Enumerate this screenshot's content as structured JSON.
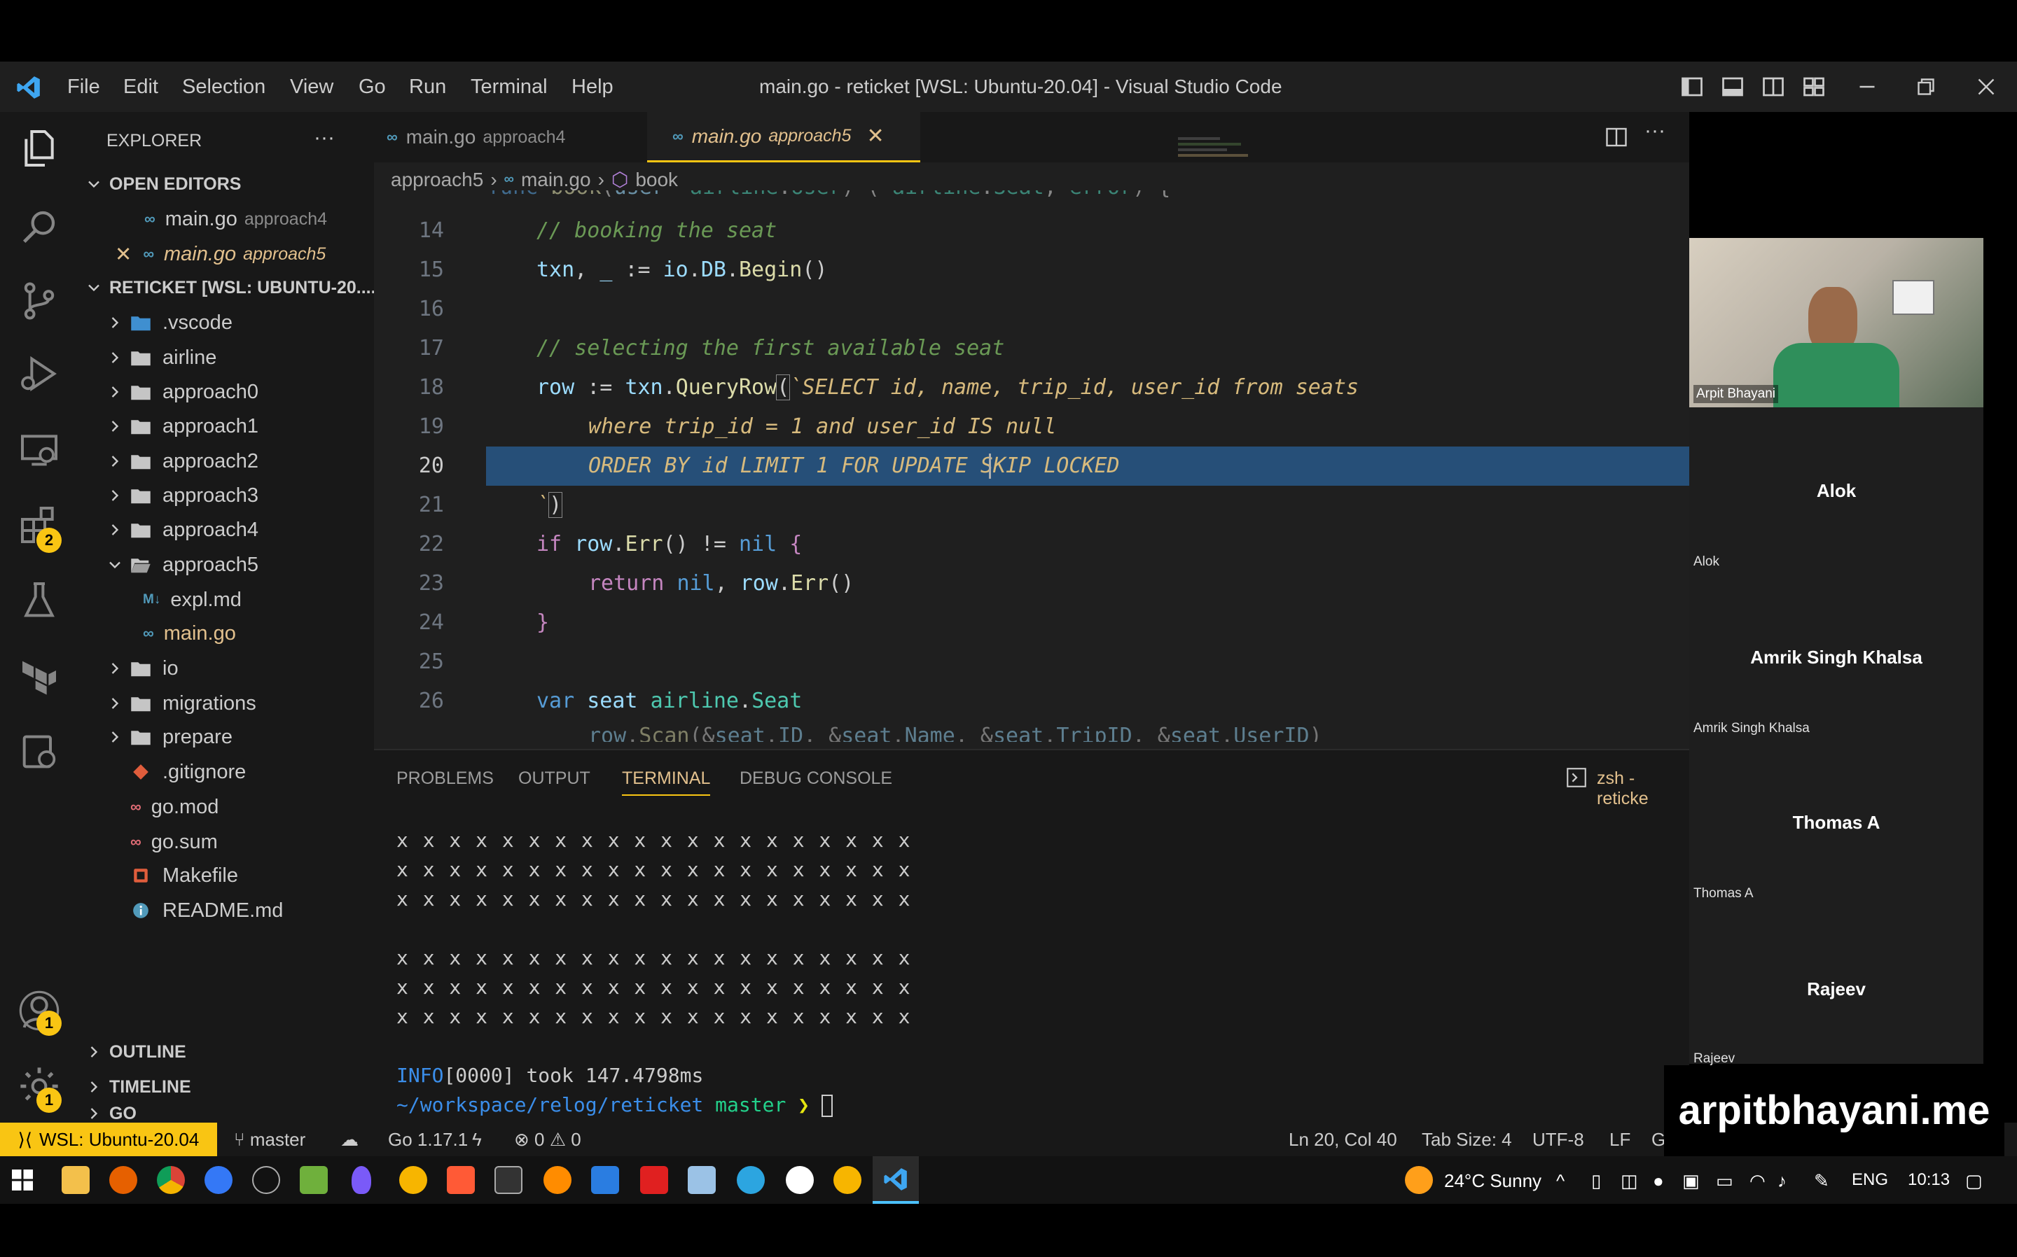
{
  "menu": [
    "File",
    "Edit",
    "Selection",
    "View",
    "Go",
    "Run",
    "Terminal",
    "Help"
  ],
  "window_title": "main.go - reticket [WSL: Ubuntu-20.04] - Visual Studio Code",
  "sidebar": {
    "explorer_title": "EXPLORER",
    "open_editors_label": "OPEN EDITORS",
    "open_editors": [
      {
        "name": "main.go",
        "folder": "approach4"
      },
      {
        "name": "main.go",
        "folder": "approach5"
      }
    ],
    "project_label": "RETICKET [WSL: UBUNTU-20....",
    "tree": [
      ".vscode",
      "airline",
      "approach0",
      "approach1",
      "approach2",
      "approach3",
      "approach4",
      "approach5",
      "expl.md",
      "main.go",
      "io",
      "migrations",
      "prepare",
      ".gitignore",
      "go.mod",
      "go.sum",
      "Makefile",
      "README.md"
    ],
    "outline_label": "OUTLINE",
    "timeline_label": "TIMELINE",
    "go_label": "GO"
  },
  "activity_badges": {
    "extensions": "2",
    "accounts": "1",
    "settings": "1"
  },
  "tabs": [
    {
      "name": "main.go",
      "folder": "approach4"
    },
    {
      "name": "main.go",
      "folder": "approach5"
    }
  ],
  "breadcrumb": {
    "folder": "approach5",
    "file": "main.go",
    "symbol": "book"
  },
  "code": {
    "line_numbers": [
      "14",
      "15",
      "16",
      "17",
      "18",
      "19",
      "20",
      "21",
      "22",
      "23",
      "24",
      "25",
      "26"
    ],
    "l14": "// booking the seat",
    "l17": "// selecting the first available seat",
    "l18_sql": "SELECT id, name, trip_id, user_id from seats",
    "l19_sql": "where trip_id = 1 and user_id IS null",
    "l20_sql": "ORDER BY id LIMIT 1 FOR UPDATE SKIP LOCKED"
  },
  "panel": {
    "tabs": [
      "PROBLEMS",
      "OUTPUT",
      "TERMINAL",
      "DEBUG CONSOLE"
    ],
    "shell": "zsh - reticke",
    "seat_row": "x x x x x x x x x x x x x x x x x x x x",
    "info_line": "INFO[0000] took 147.4798ms",
    "prompt_path": "~/workspace/relog/reticket",
    "prompt_branch": "master",
    "prompt_symbol": "❯"
  },
  "video": {
    "presenter": "Arpit Bhayani",
    "participants": [
      "Alok",
      "Amrik Singh Khalsa",
      "Thomas A",
      "Rajeev"
    ]
  },
  "watermark": "arpitbhayani.me",
  "status": {
    "remote": "WSL: Ubuntu-20.04",
    "branch": "master",
    "go_version": "Go 1.17.1",
    "errors": "0",
    "warnings": "0",
    "cursor": "Ln 20, Col 40",
    "tab_size": "Tab Size: 4",
    "encoding": "UTF-8",
    "eol": "LF",
    "lang": "G"
  },
  "taskbar": {
    "weather": "24°C  Sunny",
    "lang": "ENG",
    "time": "10:13"
  },
  "colors": {
    "accent": "#f9c513",
    "remote_bg": "#f9c513"
  }
}
